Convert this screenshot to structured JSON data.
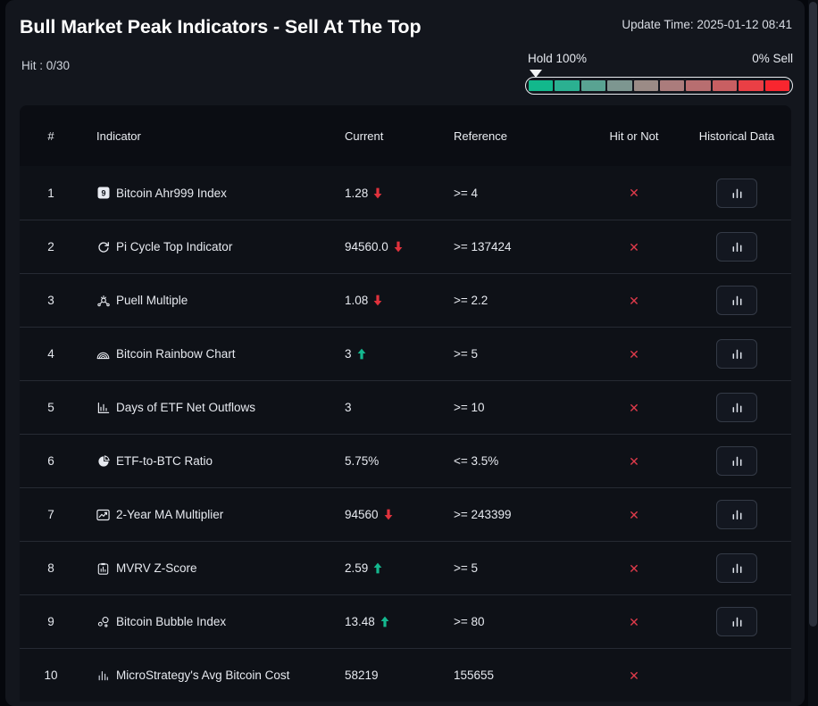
{
  "header": {
    "title": "Bull Market Peak Indicators - Sell At The Top",
    "update_time": "Update Time: 2025-01-12 08:41",
    "hit_count": "Hit : 0/30"
  },
  "gauge": {
    "left_label": "Hold 100%",
    "right_label": "0% Sell",
    "pointer_position_percent": 0,
    "segment_colors": [
      "#12b88c",
      "#2bb091",
      "#59a392",
      "#7d9690",
      "#9b8b86",
      "#ab7c7c",
      "#b86e70",
      "#c85f62",
      "#ea3f45",
      "#f8262f"
    ]
  },
  "table": {
    "columns": [
      "#",
      "Indicator",
      "Current",
      "Reference",
      "Hit or Not",
      "Historical Data"
    ],
    "rows": [
      {
        "num": "1",
        "indicator": "Bitcoin Ahr999 Index",
        "icon": "badge-9-icon",
        "current": "1.28",
        "trend": "down",
        "reference": ">= 4",
        "hit": "no",
        "hit_symbol": "✕",
        "has_history": true
      },
      {
        "num": "2",
        "indicator": "Pi Cycle Top Indicator",
        "icon": "refresh-circle-icon",
        "current": "94560.0",
        "trend": "down",
        "reference": ">= 137424",
        "hit": "no",
        "hit_symbol": "✕",
        "has_history": true
      },
      {
        "num": "3",
        "indicator": "Puell Multiple",
        "icon": "network-nodes-icon",
        "current": "1.08",
        "trend": "down",
        "reference": ">= 2.2",
        "hit": "no",
        "hit_symbol": "✕",
        "has_history": true
      },
      {
        "num": "4",
        "indicator": "Bitcoin Rainbow Chart",
        "icon": "rainbow-arc-icon",
        "current": "3",
        "trend": "up",
        "reference": ">= 5",
        "hit": "no",
        "hit_symbol": "✕",
        "has_history": true
      },
      {
        "num": "5",
        "indicator": "Days of ETF Net Outflows",
        "icon": "bar-chart-icon",
        "current": "3",
        "trend": "none",
        "reference": ">= 10",
        "hit": "no",
        "hit_symbol": "✕",
        "has_history": true
      },
      {
        "num": "6",
        "indicator": "ETF-to-BTC Ratio",
        "icon": "pie-chart-icon",
        "current": "5.75%",
        "trend": "none",
        "reference": "<= 3.5%",
        "hit": "no",
        "hit_symbol": "✕",
        "has_history": true
      },
      {
        "num": "7",
        "indicator": "2-Year MA Multiplier",
        "icon": "line-chart-icon",
        "current": "94560",
        "trend": "down",
        "reference": ">= 243399",
        "hit": "no",
        "hit_symbol": "✕",
        "has_history": true
      },
      {
        "num": "8",
        "indicator": "MVRV Z-Score",
        "icon": "clipboard-chart-icon",
        "current": "2.59",
        "trend": "up",
        "reference": ">= 5",
        "hit": "no",
        "hit_symbol": "✕",
        "has_history": true
      },
      {
        "num": "9",
        "indicator": "Bitcoin Bubble Index",
        "icon": "bubbles-icon",
        "current": "13.48",
        "trend": "up",
        "reference": ">= 80",
        "hit": "no",
        "hit_symbol": "✕",
        "has_history": true
      },
      {
        "num": "10",
        "indicator": "MicroStrategy's Avg Bitcoin Cost",
        "icon": "bar-chart-small-icon",
        "current": "58219",
        "trend": "none",
        "reference": "155655",
        "hit": "no",
        "hit_symbol": "✕",
        "has_history": false
      }
    ]
  },
  "colors": {
    "accent_up": "#14b88f",
    "accent_down": "#e0323c",
    "miss": "#e03b4b",
    "panel_bg": "#13161d",
    "table_bg": "#0e1117",
    "header_bg": "#0b0d13"
  }
}
